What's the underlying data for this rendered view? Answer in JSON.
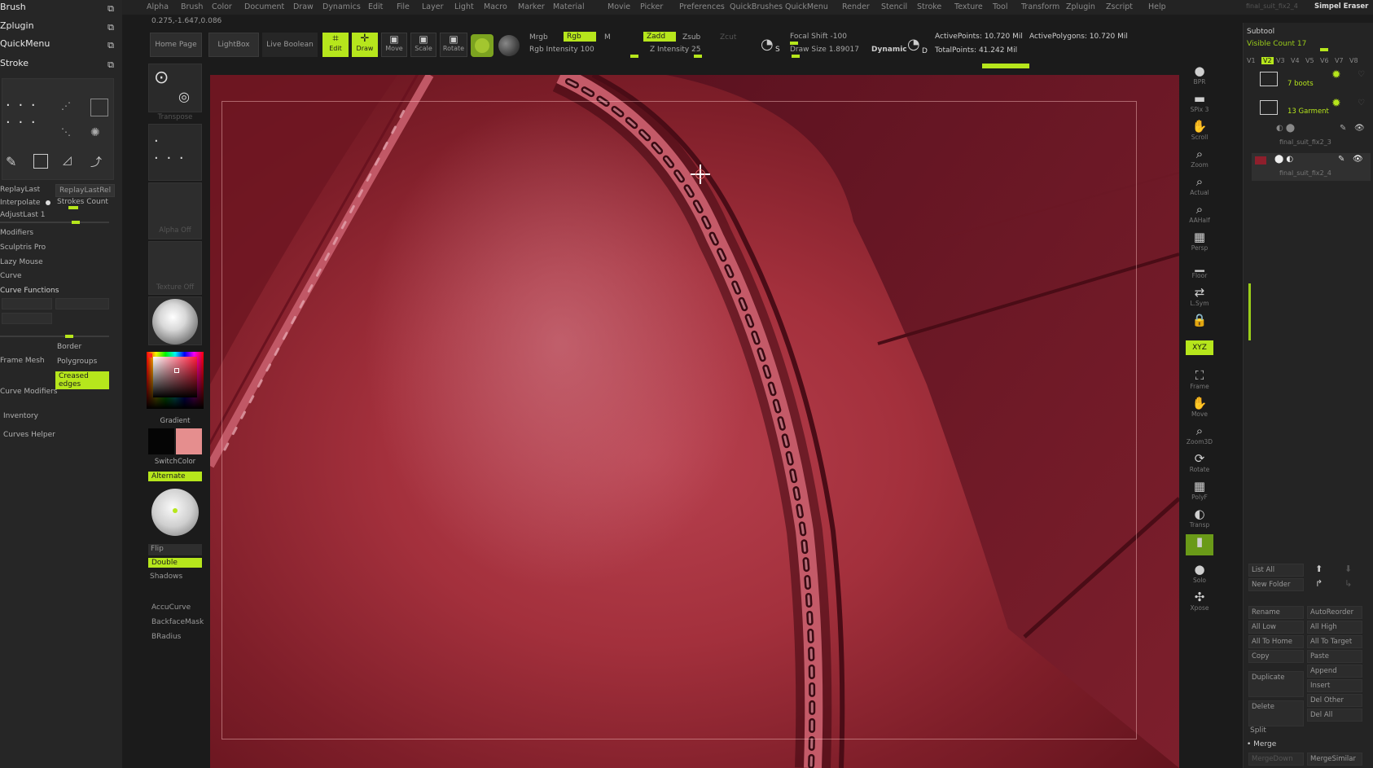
{
  "menu": {
    "items": [
      "Alpha",
      "Brush",
      "Color",
      "Document",
      "Draw",
      "Dynamics",
      "Edit",
      "File",
      "Layer",
      "Light",
      "Macro",
      "Marker",
      "Material",
      "Movie",
      "Picker",
      "Preferences",
      "QuickBrushes",
      "QuickMenu",
      "Render",
      "Stencil",
      "Stroke",
      "Texture",
      "Tool",
      "Transform",
      "Zplugin",
      "Zscript",
      "Help"
    ],
    "right_top": "Simpel Eraser"
  },
  "coords_readout": "0.275,-1.647,0.086",
  "left_palette": {
    "headers": [
      "Brush",
      "Zplugin",
      "QuickMenu",
      "Stroke"
    ],
    "row_replaylast": "ReplayLast",
    "row_replaylastrel": "ReplayLastRel",
    "row_interpolate": "Interpolate",
    "row_strokes_count": "Strokes Count",
    "row_adjustlast": "AdjustLast 1",
    "sections": [
      "Modifiers",
      "Sculptris Pro",
      "Lazy Mouse",
      "Curve",
      "Curve Functions"
    ],
    "frame_mesh": "Frame Mesh",
    "border": "Border",
    "polygroups": "Polygroups",
    "creased_edges": "Creased edges",
    "curve_modifiers": "Curve Modifiers",
    "inventory": "Inventory",
    "curves_helper": "Curves Helper"
  },
  "tool_column": {
    "transpose": "Transpose",
    "alpha_off": "Alpha Off",
    "texture_off": "Texture Off",
    "gradient": "Gradient",
    "switch_color": "SwitchColor",
    "alternate": "Alternate",
    "flip": "Flip",
    "double": "Double",
    "shadows": "Shadows",
    "accucurve": "AccuCurve",
    "backfacemask": "BackfaceMask",
    "bradius": "BRadius"
  },
  "shelf": {
    "home_page": "Home Page",
    "lightbox": "LightBox",
    "live_boolean": "Live Boolean",
    "edit": "Edit",
    "draw": "Draw",
    "move": "Move",
    "scale": "Scale",
    "rotate": "Rotate",
    "mrgb": "Mrgb",
    "rgb": "Rgb",
    "m": "M",
    "rgb_intensity": "Rgb Intensity 100",
    "zadd": "Zadd",
    "zsub": "Zsub",
    "zcut": "Zcut",
    "z_intensity": "Z Intensity 25",
    "focal_shift": "Focal Shift -100",
    "draw_size": "Draw Size 1.89017",
    "dynamic": "Dynamic",
    "active_points": "ActivePoints: 10.720 Mil",
    "active_polygons": "ActivePolygons: 10.720 Mil",
    "total_points": "TotalPoints: 41.242 Mil"
  },
  "right_strip": [
    {
      "name": "bpr-icon",
      "glyph": "●",
      "label": "BPR"
    },
    {
      "name": "spix-icon",
      "glyph": "▬",
      "label": "SPix 3"
    },
    {
      "name": "scroll-icon",
      "glyph": "✋",
      "label": "Scroll"
    },
    {
      "name": "zoom-icon",
      "glyph": "⌕",
      "label": "Zoom"
    },
    {
      "name": "actual-icon",
      "glyph": "⌕",
      "label": "Actual"
    },
    {
      "name": "aahalf-icon",
      "glyph": "⌕",
      "label": "AAHalf"
    },
    {
      "name": "persp-icon",
      "glyph": "▦",
      "label": "Persp"
    },
    {
      "name": "floor-icon",
      "glyph": "▁",
      "label": "Floor"
    },
    {
      "name": "lsym-icon",
      "glyph": "⇄",
      "label": "L.Sym"
    },
    {
      "name": "lock-icon",
      "glyph": "🔒",
      "label": ""
    },
    {
      "name": "xyz-icon",
      "glyph": "XYZ",
      "label": ""
    },
    {
      "name": "frame-icon",
      "glyph": "⛶",
      "label": "Frame"
    },
    {
      "name": "move-icon",
      "glyph": "✋",
      "label": "Move"
    },
    {
      "name": "zoom3d-icon",
      "glyph": "⌕",
      "label": "Zoom3D"
    },
    {
      "name": "rotate-icon",
      "glyph": "⟳",
      "label": "Rotate"
    },
    {
      "name": "polyf-icon",
      "glyph": "▦",
      "label": "PolyF"
    },
    {
      "name": "transp-icon",
      "glyph": "◐",
      "label": "Transp"
    },
    {
      "name": "ghost-icon",
      "glyph": "▮",
      "label": ""
    },
    {
      "name": "solo-icon",
      "glyph": "●",
      "label": "Solo"
    },
    {
      "name": "xpose-icon",
      "glyph": "✣",
      "label": "Xpose"
    }
  ],
  "subtool": {
    "title": "Subtool",
    "visible_count": "Visible Count 17",
    "versions": [
      "V1",
      "V2",
      "V3",
      "V4",
      "V5",
      "V6",
      "V7",
      "V8"
    ],
    "folder1": "7 boots",
    "folder2": "13 Garment",
    "item1": "final_suit_fix2_3",
    "item2": "final_suit_fix2_4",
    "list_all": "List All",
    "new_folder": "New Folder",
    "buttons": [
      "Rename",
      "AutoReorder",
      "All Low",
      "All High",
      "All To Home",
      "All To Target",
      "Copy",
      "Paste",
      "Duplicate",
      "Append",
      "Insert",
      "Delete",
      "Del Other",
      "Del All"
    ],
    "split": "Split",
    "merge": "Merge",
    "mergedown": "MergeDown",
    "mergesimilar": "MergeSimilar",
    "top_label": "final_suit_fix2_4"
  },
  "colors": {
    "accent": "#b6e61c",
    "leather": "#a3303c",
    "background": "#1b1b1b"
  }
}
